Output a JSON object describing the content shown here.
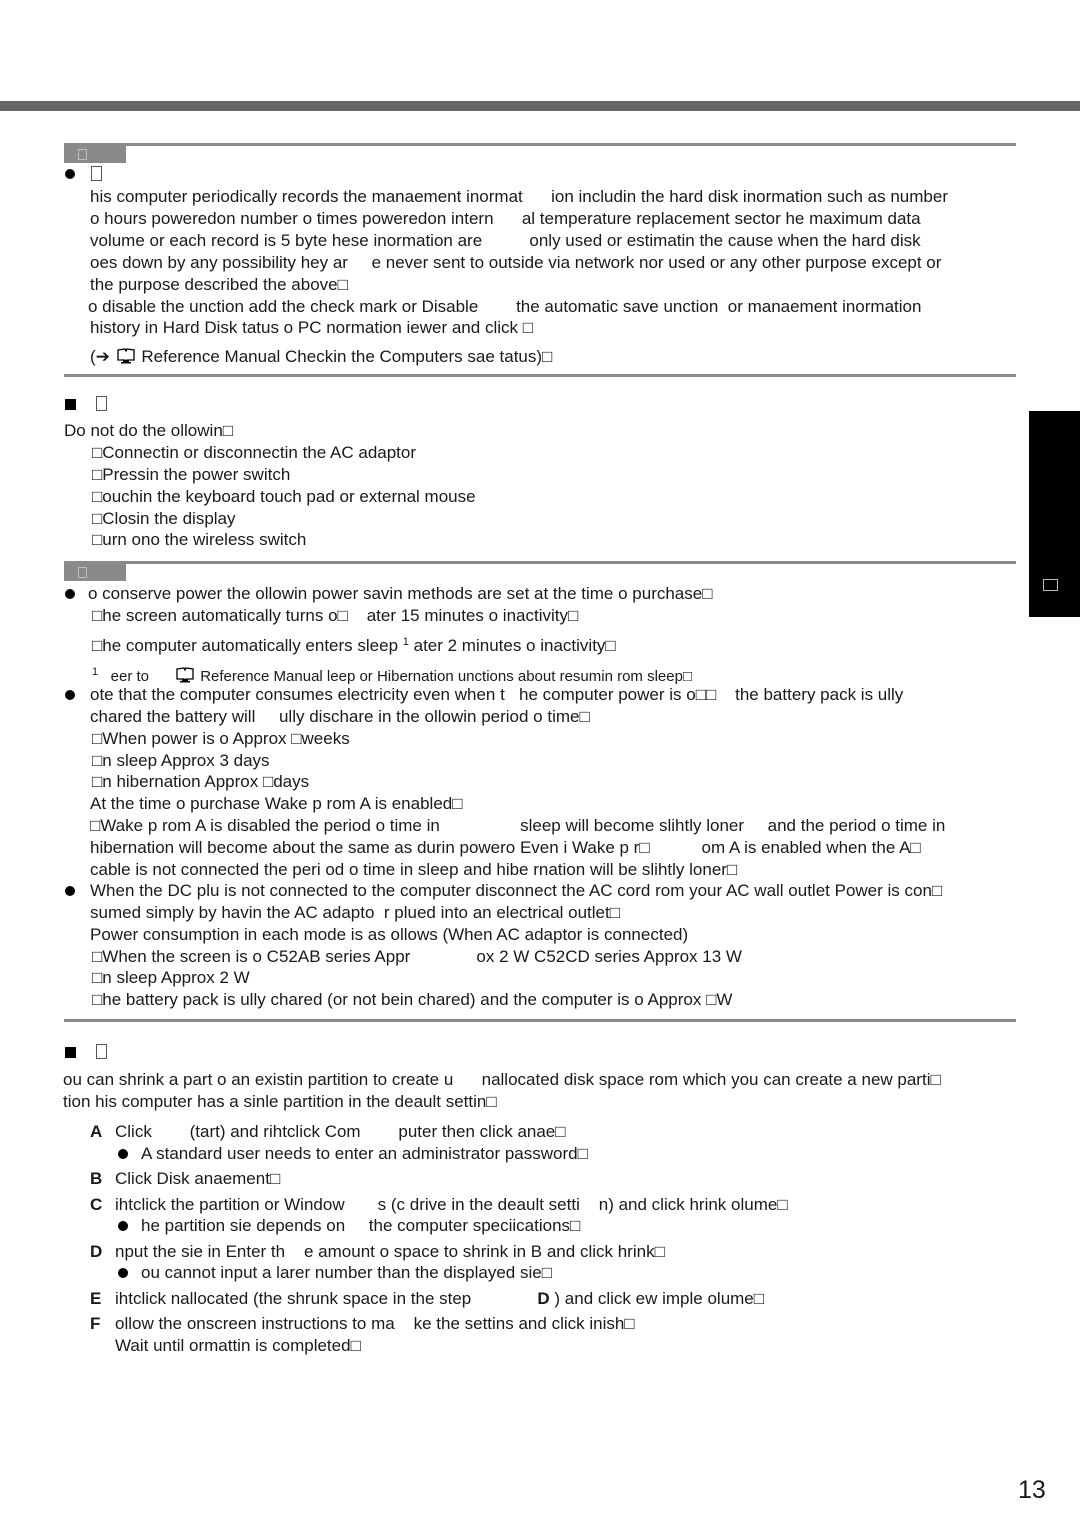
{
  "page_number": "13",
  "side_tab": {
    "label": "□"
  },
  "section1": {
    "tag_label": "□",
    "bullet_heading": "□",
    "paragraph_lines": [
      "his computer periodically records the manaement inormat      ion includin the hard disk inormation such as number",
      "o hours poweredon number o times poweredon intern      al temperature replacement sector he maximum data",
      "volume or each record is 5 byte hese inormation are          only used or estimatin the cause when the hard disk",
      "oes down by any possibility hey ar     e never sent to outside via network nor used or any other purpose except or",
      "the purpose described the above□"
    ],
    "disable_lines": [
      "o disable the unction add the check mark or Disable        the automatic save unction  or manaement inormation",
      "history in Hard Disk tatus o PC normation iewer and click □"
    ],
    "reference": "Reference Manual Checkin the Computers sae tatus)□"
  },
  "section2": {
    "heading": "□",
    "intro": "Do not do the ollowin□",
    "items": [
      "□Connectin or disconnectin the AC adaptor",
      "□Pressin the power switch",
      "□ouchin the keyboard touch pad or external mouse",
      "□Closin the display",
      "□urn ono the wireless switch"
    ]
  },
  "section3": {
    "tag_label": "□",
    "b1": {
      "text": "o conserve power the ollowin power savin methods are set at the time o purchase□",
      "line2": "□he screen automatically turns o□    ater 15 minutes o inactivity□",
      "line3a": "□he computer automatically enters sleep ",
      "line3sup": "1",
      "line3b": " ater 2 minutes o inactivity□",
      "footnote_mark": "1",
      "footnote_a": "eer to",
      "footnote_b": "Reference Manual leep or Hibernation unctions about resumin rom sleep□"
    },
    "b2": {
      "lines": [
        "ote that the computer consumes electricity even when t   he computer power is o□□    the battery pack is ully",
        "chared the battery will     ully dischare in the ollowin period o time□",
        "□When power is o Approx □weeks",
        "□n sleep Approx 3 days",
        "□n hibernation Approx □days",
        "At the time o purchase Wake p rom A is enabled□",
        "□Wake p rom A is disabled the period o time in                 sleep will become slihtly loner     and the period o time in",
        "hibernation will become about the same as durin powero Even i Wake p r□           om A is enabled when the A□",
        "cable is not connected the peri od o time in sleep and hibe rnation will be slihtly loner□"
      ]
    },
    "b3": {
      "lines": [
        "When the DC plu is not connected to the computer disconnect the AC cord rom your AC wall outlet Power is con□",
        "sumed simply by havin the AC adapto  r plued into an electrical outlet□",
        "Power consumption in each mode is as ollows (When AC adaptor is connected)",
        "□When the screen is o C52AB series Appr              ox 2 W C52CD series Approx 13 W",
        "□n sleep Approx 2 W",
        "□he battery pack is ully chared (or not bein chared) and the computer is o Approx □W"
      ]
    }
  },
  "section4": {
    "heading": "□",
    "intro_lines": [
      "ou can shrink a part o an existin partition to create u      nallocated disk space rom which you can create a new parti□",
      "tion his computer has a sinle partition in the deault settin□"
    ],
    "steps": [
      {
        "letter": "A",
        "text": "Click        (tart) and rihtclick Com        puter then click anae□",
        "note": "A standard user needs to enter an administrator password□"
      },
      {
        "letter": "B",
        "text": "Click Disk anaement□"
      },
      {
        "letter": "C",
        "text": "ihtclick the partition or Window       s (c drive in the deault setti    n) and click hrink olume□",
        "note": "he partition sie depends on     the computer speciications□"
      },
      {
        "letter": "D",
        "text": "nput the sie in Enter th    e amount o space to shrink in B and click hrink□",
        "note": "ou cannot input a larer number than the displayed sie□"
      },
      {
        "letter": "E",
        "text_a": "ihtclick nallocated (the shrunk space in the step",
        "ref": "D",
        "text_b": ") and click ew imple olume□"
      },
      {
        "letter": "F",
        "text": "ollow the onscreen instructions to ma    ke the settins and click inish□",
        "text2": "Wait until ormattin is completed□"
      }
    ]
  }
}
